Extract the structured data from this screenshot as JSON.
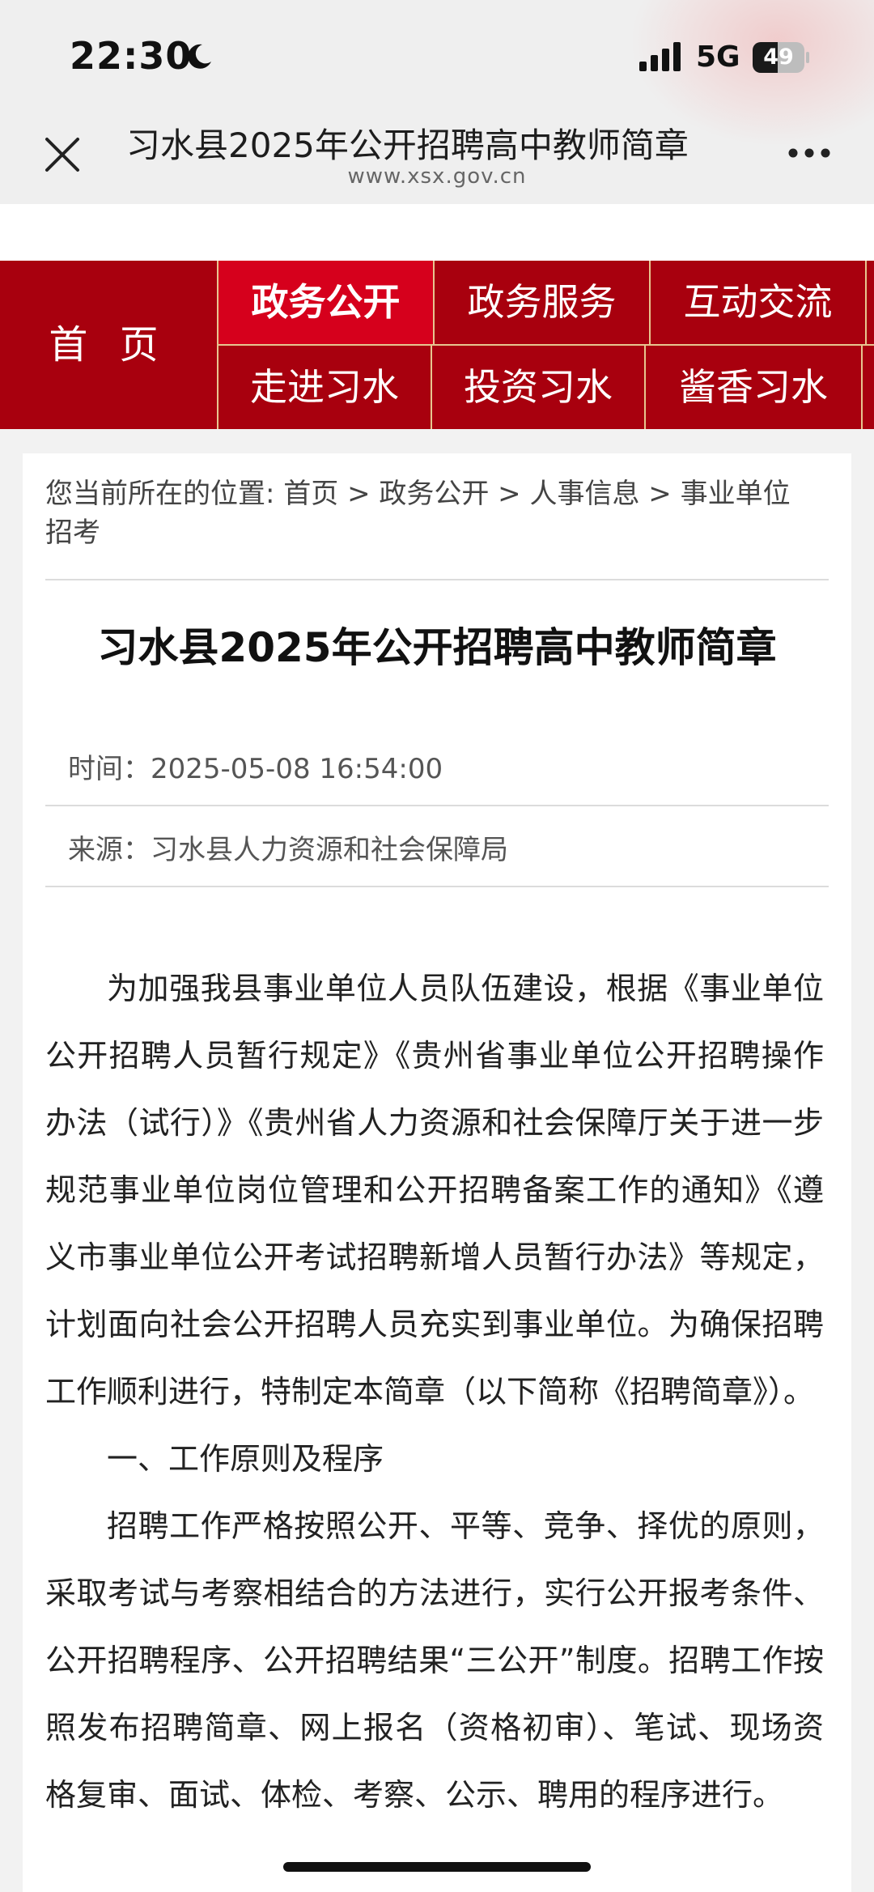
{
  "status_bar": {
    "time": "22:30",
    "network": "5G",
    "battery": "49",
    "battery_level": 0.49,
    "icons": [
      "moon-icon",
      "signal-icon",
      "battery-icon"
    ]
  },
  "browser": {
    "page_title": "习水县2025年公开招聘高中教师简章",
    "domain": "www.xsx.gov.cn",
    "icons": [
      "close-icon",
      "more-icon"
    ]
  },
  "nav": {
    "home": "首 页",
    "items": [
      {
        "label": "政务公开",
        "active": true
      },
      {
        "label": "政务服务",
        "active": false
      },
      {
        "label": "互动交流",
        "active": false
      },
      {
        "label": "走进习水",
        "active": false
      },
      {
        "label": "投资习水",
        "active": false
      },
      {
        "label": "酱香习水",
        "active": false
      }
    ],
    "colors": {
      "background": "#a8000e",
      "active": "#d6001c",
      "divider": "#e7c590"
    }
  },
  "breadcrumb": {
    "prefix": "您当前所在的位置: ",
    "separator": " > ",
    "items": [
      "首页",
      "政务公开",
      "人事信息",
      "事业单位招考"
    ]
  },
  "article": {
    "title": "习水县2025年公开招聘高中教师简章",
    "time_label": "时间：",
    "time_value": "2025-05-08 16:54:00",
    "source_label": "来源：",
    "source_value": "习水县人力资源和社会保障局",
    "paragraphs": [
      "为加强我县事业单位人员队伍建设，根据《事业单位公开招聘人员暂行规定》《贵州省事业单位公开招聘操作办法（试行）》《贵州省人力资源和社会保障厅关于进一步规范事业单位岗位管理和公开招聘备案工作的通知》《遵义市事业单位公开考试招聘新增人员暂行办法》等规定，计划面向社会公开招聘人员充实到事业单位。为确保招聘工作顺利进行，特制定本简章（以下简称《招聘简章》）。",
      "一、工作原则及程序",
      "招聘工作严格按照公开、平等、竞争、择优的原则，采取考试与考察相结合的方法进行，实行公开报考条件、公开招聘程序、公开招聘结果“三公开”制度。招聘工作按照发布招聘简章、网上报名（资格初审）、笔试、现场资格复审、面试、体检、考察、公示、聘用的程序进行。"
    ]
  }
}
